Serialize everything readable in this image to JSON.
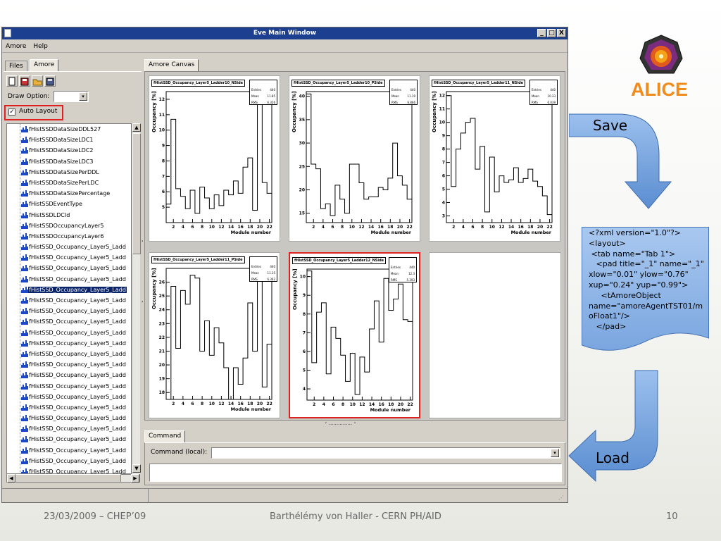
{
  "window": {
    "title": "Eve Main Window",
    "min": "_",
    "max": "□",
    "close": "X"
  },
  "menu": {
    "amore": "Amore",
    "help": "Help"
  },
  "left_tabs": [
    "Files",
    "Amore"
  ],
  "draw_option_label": "Draw Option:",
  "auto_layout_label": "Auto Layout",
  "tree_items": [
    "fHistSSDDataSizeDDL527",
    "fHistSSDDataSizeLDC1",
    "fHistSSDDataSizeLDC2",
    "fHistSSDDataSizeLDC3",
    "fHistSSDDataSizePerDDL",
    "fHistSSDDataSizePerLDC",
    "fHistSSDDataSizePercentage",
    "fHistSSDEventType",
    "fHistSSDLDCId",
    "fHistSSDOccupancyLayer5",
    "fHistSSDOccupancyLayer6",
    "fHistSSD_Occupancy_Layer5_Ladd",
    "fHistSSD_Occupancy_Layer5_Ladd",
    "fHistSSD_Occupancy_Layer5_Ladd",
    "fHistSSD_Occupancy_Layer5_Ladd",
    "fHistSSD_Occupancy_Layer5_Ladd",
    "fHistSSD_Occupancy_Layer5_Ladd",
    "fHistSSD_Occupancy_Layer5_Ladd",
    "fHistSSD_Occupancy_Layer5_Ladd",
    "fHistSSD_Occupancy_Layer5_Ladd",
    "fHistSSD_Occupancy_Layer5_Ladd",
    "fHistSSD_Occupancy_Layer5_Ladd",
    "fHistSSD_Occupancy_Layer5_Ladd",
    "fHistSSD_Occupancy_Layer5_Ladd",
    "fHistSSD_Occupancy_Layer5_Ladd",
    "fHistSSD_Occupancy_Layer5_Ladd",
    "fHistSSD_Occupancy_Layer5_Ladd",
    "fHistSSD_Occupancy_Layer5_Ladd",
    "fHistSSD_Occupancy_Layer5_Ladd",
    "fHistSSD_Occupancy_Layer5_Ladd",
    "fHistSSD_Occupancy_Layer5_Ladd",
    "fHistSSD_Occupancy_Layer5_Ladd",
    "fHistSSD_Occupancy_Layer5_Ladd"
  ],
  "selected_tree_index": 15,
  "canvas_tab": "Amore Canvas",
  "command_tab": "Command",
  "command_label": "Command (local):",
  "histograms": [
    {
      "title": "fHistSSD_Occupancy_Layer5_Ladder10_NSide",
      "entries": "440",
      "mean": "11.85",
      "rms": "6.326",
      "xlabel": "Module number",
      "ylabel": "Occupancy [%]",
      "ylim": [
        4,
        12.5
      ],
      "yticks": [
        5,
        6,
        7,
        8,
        9,
        10,
        11,
        12
      ],
      "values": [
        5.2,
        10.7,
        6.2,
        5.7,
        4.9,
        6.1,
        4.6,
        6.3,
        5.6,
        4.9,
        5.8,
        5.1,
        6.1,
        5.8,
        6.7,
        5.9,
        7.6,
        8.2,
        4.8,
        12.6,
        6.6,
        5.9
      ]
    },
    {
      "title": "fHistSSD_Occupancy_Layer5_Ladder10_PSide",
      "entries": "440",
      "mean": "11.19",
      "rms": "6.866",
      "xlabel": "Module number",
      "ylabel": "Occupancy [%]",
      "ylim": [
        13,
        41
      ],
      "yticks": [
        15,
        20,
        25,
        30,
        35,
        40
      ],
      "values": [
        40.5,
        25.5,
        24.5,
        16,
        17,
        14.5,
        21,
        18,
        15,
        25.5,
        25.5,
        21.5,
        18,
        18.5,
        18.5,
        20.5,
        20,
        22.5,
        30,
        23,
        21,
        18
      ]
    },
    {
      "title": "fHistSSD_Occupancy_Layer5_Ladder11_NSide",
      "entries": "440",
      "mean": "10.33",
      "rms": "6.039",
      "xlabel": "Module number",
      "ylabel": "Occupancy [%]",
      "ylim": [
        2.5,
        12.3
      ],
      "yticks": [
        3,
        4,
        5,
        6,
        7,
        8,
        9,
        10,
        11,
        12
      ],
      "values": [
        12,
        5.2,
        8,
        9.2,
        10,
        10.3,
        6.5,
        8.2,
        3.3,
        7.4,
        4.8,
        6,
        5.5,
        5.7,
        6.6,
        5.5,
        5.8,
        6.5,
        5.6,
        5.2,
        4.5,
        3.1
      ]
    },
    {
      "title": "fHistSSD_Occupancy_Layer5_Ladder11_PSide",
      "entries": "440",
      "mean": "11.15",
      "rms": "6.362",
      "xlabel": "Module number",
      "ylabel": "Occupancy [%]",
      "ylim": [
        17.5,
        27
      ],
      "yticks": [
        18,
        19,
        20,
        21,
        22,
        23,
        24,
        25,
        26
      ],
      "values": [
        17.2,
        25.7,
        21.2,
        25.4,
        24.4,
        26.5,
        26.3,
        21,
        23.2,
        20.7,
        22.7,
        21.6,
        19.8,
        17.3,
        19.8,
        18.6,
        20.5,
        24.5,
        21,
        26.4,
        18.4,
        21.5
      ]
    },
    {
      "title": "fHistSSD_Occupancy_Layer5_Ladder12_NSide",
      "entries": "440",
      "mean": "12.3",
      "rms": "5.393",
      "xlabel": "Module number",
      "ylabel": "Occupancy [%]",
      "ylim": [
        3.4,
        10.4
      ],
      "yticks": [
        4,
        5,
        6,
        7,
        8,
        9,
        10
      ],
      "values": [
        10.3,
        5.4,
        8.1,
        8.6,
        4.8,
        7.3,
        6.7,
        5.8,
        4.4,
        5.9,
        3.7,
        5.7,
        4.9,
        7.2,
        8.7,
        6.5,
        9.9,
        8.2,
        8.8,
        9.6,
        7.7,
        7.6
      ]
    }
  ],
  "xticks": [
    2,
    4,
    6,
    8,
    10,
    12,
    14,
    16,
    18,
    20,
    22
  ],
  "side_labels": {
    "save": "Save",
    "load": "Load"
  },
  "xml_lines": [
    "<?xml version=\"1.0\"?>",
    "<layout>",
    " <tab name=\"Tab 1\">",
    "   <pad title=\"_1\" name=\"_1\"",
    "xlow=\"0.01\" ylow=\"0.76\"",
    "xup=\"0.24\" yup=\"0.99\">",
    "     <tAmoreObject",
    "name=\"amoreAgentTST01/m",
    "oFloat1\"/>",
    "   </pad>"
  ],
  "logo_text": "ALICE",
  "footer": {
    "date": "23/03/2009 – CHEP’09",
    "author": "Barthélémy von Haller - CERN PH/AID",
    "page": "10"
  },
  "colors": {
    "title_bar": "#1c3f8f",
    "selected_pad": "#dd2222",
    "callout": "#6f9edb",
    "alice_orange": "#f08c1e"
  }
}
